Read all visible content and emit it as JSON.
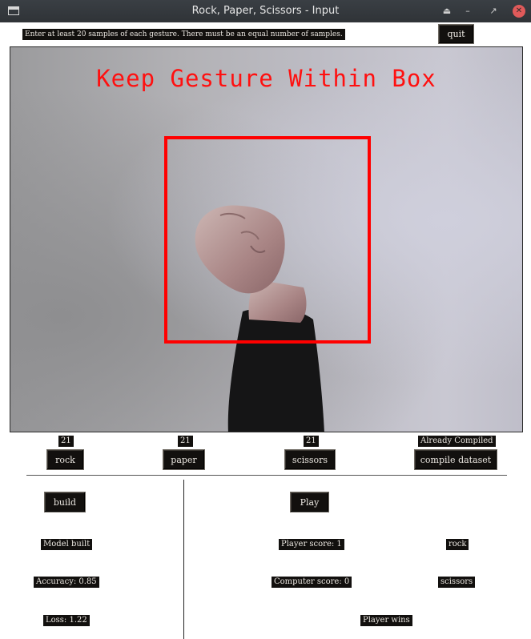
{
  "window": {
    "title": "Rock, Paper, Scissors - Input"
  },
  "header": {
    "instructions": "Enter at least 20 samples of each gesture. There must be an equal number of samples.",
    "quit_label": "quit"
  },
  "video": {
    "caption": "Keep Gesture Within Box",
    "box_color": "#ff0000"
  },
  "samples": {
    "rock_count": "21",
    "paper_count": "21",
    "scissors_count": "21",
    "compile_status": "Already Compiled",
    "rock_label": "rock",
    "paper_label": "paper",
    "scissors_label": "scissors",
    "compile_label": "compile dataset"
  },
  "model": {
    "build_label": "build",
    "status": "Model built",
    "accuracy": "Accuracy: 0.85",
    "loss": "Loss: 1.22"
  },
  "game": {
    "play_label": "Play",
    "player_score": "Player score: 1",
    "computer_score": "Computer score: 0",
    "player_choice": "rock",
    "computer_choice": "scissors",
    "result": "Player wins"
  }
}
